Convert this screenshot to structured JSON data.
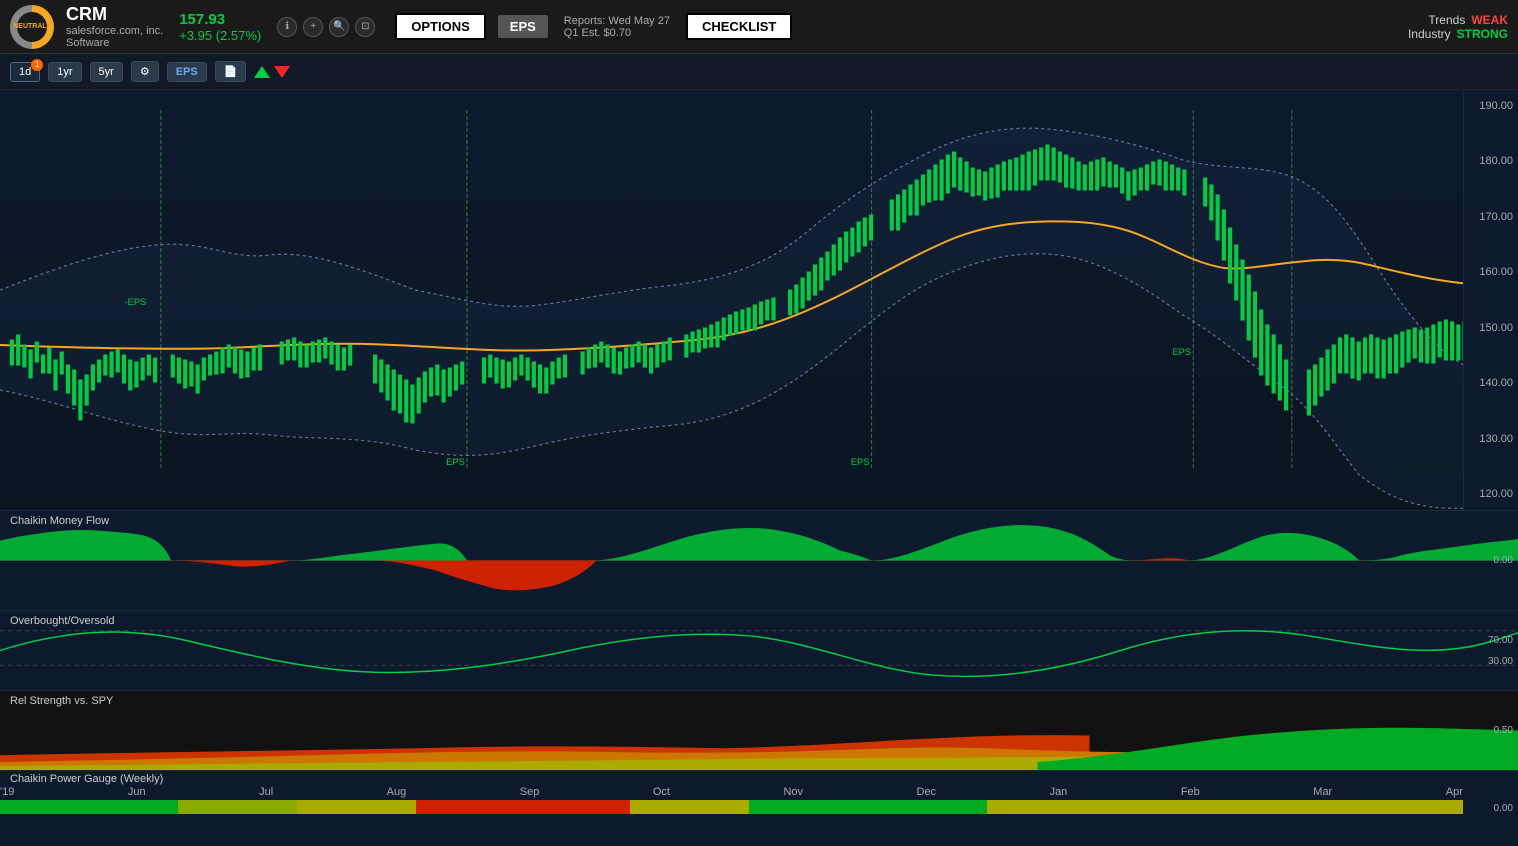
{
  "header": {
    "ticker": "CRM",
    "company": "salesforce.com, inc.",
    "sector": "Software",
    "rating": "NEUTRAL+",
    "price": "157.93",
    "change": "+3.95",
    "change_pct": "(2.57%)",
    "options_label": "OPTIONS",
    "eps_label": "EPS",
    "reports_line1": "Reports:  Wed May 27",
    "reports_line2": "Q1  Est.  $0.70",
    "checklist_label": "CHECKLIST",
    "trends_label": "Trends",
    "trends_value": "WEAK",
    "industry_label": "Industry",
    "industry_value": "STRONG"
  },
  "toolbar": {
    "period_1d": "1d",
    "period_1yr": "1yr",
    "period_5yr": "5yr",
    "settings_icon": "⚙",
    "eps_btn": "EPS",
    "doc_icon": "📄",
    "badge_count": "1"
  },
  "chart": {
    "price_labels": [
      "190.00",
      "180.00",
      "170.00",
      "160.00",
      "150.00",
      "140.00",
      "130.00",
      "120.00"
    ],
    "eps_labels": [
      "EPS",
      "EPS",
      "EPS",
      "EPS",
      "EPS"
    ],
    "cmf_label": "Chaikin Money Flow",
    "cmf_scale": [
      "0.00"
    ],
    "ob_os_label": "Overbought/Oversold",
    "ob_os_scale": [
      "70.00",
      "30.00"
    ],
    "rel_strength_label": "Rel Strength vs. SPY",
    "rel_scale": [
      "0.50"
    ],
    "power_gauge_label": "Chaikin Power Gauge (Weekly)",
    "power_gauge_scale": [
      "0.00"
    ]
  },
  "x_axis": {
    "labels": [
      "'19",
      "Jun",
      "Jul",
      "Aug",
      "Sep",
      "Oct",
      "Nov",
      "Dec",
      "Jan",
      "Feb",
      "Mar",
      "Apr"
    ]
  }
}
